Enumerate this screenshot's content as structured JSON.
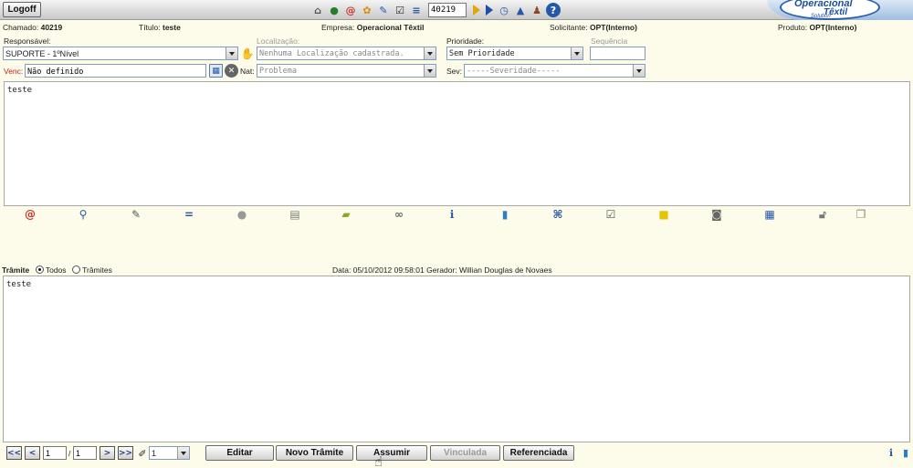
{
  "topbar": {
    "logoff_label": "Logoff",
    "ticket_number": "40219"
  },
  "brand": {
    "line1": "Operacional",
    "line2": "Têxtil",
    "line3": "Solution"
  },
  "info": {
    "chamado_label": "Chamado:",
    "chamado_value": "40219",
    "titulo_label": "Título:",
    "titulo_value": "teste",
    "empresa_label": "Empresa:",
    "empresa_value": "Operacional Têxtil",
    "solicitante_label": "Solicitante:",
    "solicitante_value": "OPT(Interno)",
    "produto_label": "Produto:",
    "produto_value": "OPT(Interno)"
  },
  "form": {
    "responsavel_label": "Responsável:",
    "responsavel_value": "SUPORTE - 1ºNível",
    "localizacao_label": "Localização:",
    "localizacao_value": "Nenhuma Localização cadastrada.",
    "prioridade_label": "Prioridade:",
    "prioridade_value": "Sem Prioridade",
    "sequencia_label": "Sequência",
    "sequencia_value": "",
    "venc_label": "Venc:",
    "venc_value": "Não definido",
    "nat_label": "Nat:",
    "nat_value": "Problema",
    "sev_label": "Sev:",
    "sev_value": "-----Severidade-----"
  },
  "description_text": "teste",
  "tramite": {
    "label": "Trâmite",
    "opt_todos": "Todos",
    "opt_tramites": "Trâmites",
    "data_label": "Data:",
    "data_value": "05/10/2012 09:58:01",
    "gerador_label": "Gerador:",
    "gerador_value": "Willian Douglas de Novaes",
    "text": "teste"
  },
  "pagination": {
    "first": "<<",
    "prev": "<",
    "current": "1",
    "separator": "/",
    "total": "1",
    "next": ">",
    "last": ">>",
    "per_page": "1"
  },
  "actions": {
    "editar": "Editar",
    "novo_tramite": "Novo Trâmite",
    "assumir": "Assumir",
    "vinculada": "Vinculada",
    "referenciada": "Referenciada"
  },
  "colors": {
    "background": "#fdfcea",
    "accent_blue": "#1d4f9a",
    "required_red": "#cc1b1b"
  }
}
